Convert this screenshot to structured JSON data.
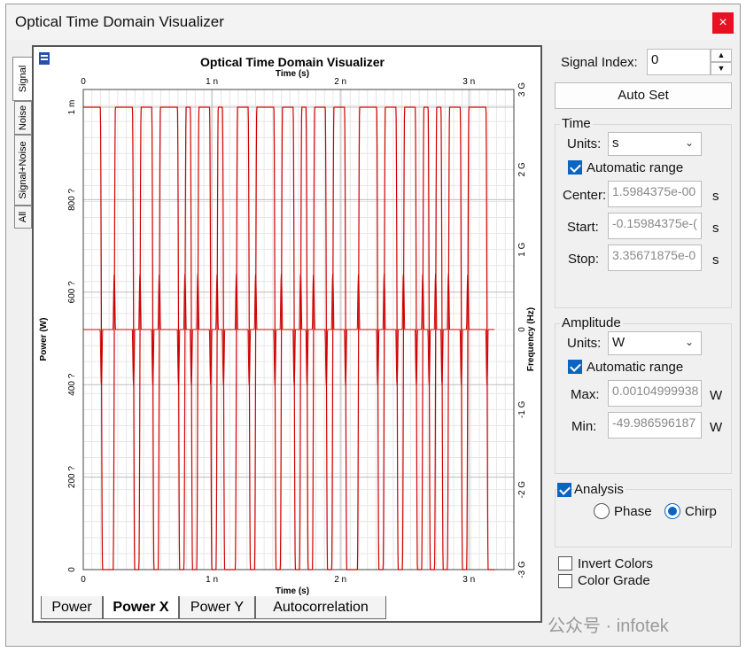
{
  "window": {
    "title": "Optical Time Domain Visualizer",
    "close_glyph": "×"
  },
  "side_tabs": [
    "Signal",
    "Noise",
    "Signal+Noise",
    "All"
  ],
  "bottom_tabs": [
    "Power",
    "Power X",
    "Power Y",
    "Autocorrelation"
  ],
  "plot": {
    "title": "Optical Time Domain Visualizer",
    "x_label_top": "Time (s)",
    "x_label_bottom": "Time (s)",
    "y_label_left": "Power (W)",
    "y_label_right": "Frequency (Hz)",
    "x_ticks": [
      "0",
      "1 n",
      "2 n",
      "3 n"
    ],
    "y_left_ticks": [
      "0",
      "200 ?",
      "400 ?",
      "600 ?",
      "800 ?",
      "1 m"
    ],
    "y_right_ticks": [
      "-3 G",
      "-2 G",
      "-1 G",
      "0",
      "1 G",
      "2 G",
      "3 G"
    ],
    "trace_color": "#d00000"
  },
  "chart_data": {
    "type": "line",
    "title": "Optical Time Domain Visualizer",
    "xlabel": "Time (s)",
    "ylabel": "Power (W)",
    "y2label": "Frequency (Hz)",
    "xlim": [
      0,
      3.35e-09
    ],
    "ylim": [
      0,
      0.001
    ],
    "y2lim": [
      -3000000000.0,
      3000000000.0
    ],
    "grid": true,
    "bits": [
      1,
      1,
      1,
      0,
      0,
      1,
      1,
      1,
      0,
      1,
      1,
      0,
      1,
      1,
      1,
      0,
      1,
      0,
      1,
      1,
      0,
      1,
      0,
      0,
      1,
      1,
      0,
      1,
      1,
      1,
      0,
      1,
      1,
      0,
      1,
      0,
      1,
      1,
      0,
      1,
      1,
      0,
      0,
      1,
      1,
      1,
      0,
      1,
      1,
      0,
      1,
      1,
      0,
      1,
      0,
      1,
      0,
      1,
      1,
      0,
      1,
      1,
      1,
      0
    ],
    "bit_period": 5e-11,
    "series": [
      {
        "name": "Power X",
        "axis": "left",
        "kind": "nrz"
      },
      {
        "name": "Chirp",
        "axis": "right",
        "kind": "derivative"
      }
    ]
  },
  "controls": {
    "signal_index_label": "Signal Index:",
    "signal_index_value": "0",
    "auto_set": "Auto Set",
    "time_group": "Time",
    "units_label": "Units:",
    "time_units": "s",
    "auto_range_label": "Automatic range",
    "center_label": "Center:",
    "center_value": "1.5984375e-00",
    "start_label": "Start:",
    "start_value": "-0.15984375e-(",
    "stop_label": "Stop:",
    "stop_value": "3.35671875e-0",
    "unit_s": "s",
    "amplitude_group": "Amplitude",
    "amp_units": "W",
    "max_label": "Max:",
    "max_value": "0.00104999938",
    "min_label": "Min:",
    "min_value": "-49.986596187",
    "unit_w": "W",
    "analysis_label": "Analysis",
    "phase_label": "Phase",
    "chirp_label": "Chirp",
    "invert_colors": "Invert Colors",
    "color_grade": "Color Grade"
  },
  "watermark": "公众号 · infotek"
}
